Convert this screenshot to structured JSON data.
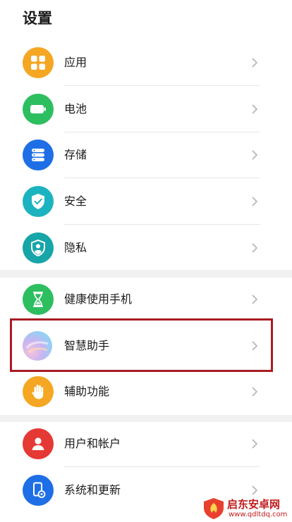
{
  "page_title": "设置",
  "groups": [
    {
      "items": [
        {
          "label": "应用",
          "icon": "apps-grid-icon",
          "color": "#F5A623"
        },
        {
          "label": "电池",
          "icon": "battery-icon",
          "color": "#2DBE60"
        },
        {
          "label": "存储",
          "icon": "storage-icon",
          "color": "#1E6FE6"
        },
        {
          "label": "安全",
          "icon": "shield-check-icon",
          "color": "#1BB3C0"
        },
        {
          "label": "隐私",
          "icon": "privacy-shield-icon",
          "color": "#17A5A8"
        }
      ]
    },
    {
      "items": [
        {
          "label": "健康使用手机",
          "icon": "hourglass-icon",
          "color": "#2DBE60"
        },
        {
          "label": "智慧助手",
          "icon": "smart-assistant-icon",
          "color": "#c8b4f0",
          "highlighted": true
        },
        {
          "label": "辅助功能",
          "icon": "hand-icon",
          "color": "#F5A623"
        }
      ]
    },
    {
      "items": [
        {
          "label": "用户和帐户",
          "icon": "user-icon",
          "color": "#E53935"
        },
        {
          "label": "系统和更新",
          "icon": "system-update-icon",
          "color": "#1E6FE6"
        }
      ]
    }
  ],
  "highlight_color": "#a81c22",
  "watermark": {
    "title": "启东安卓网",
    "url": "www.qdltdq.com"
  }
}
